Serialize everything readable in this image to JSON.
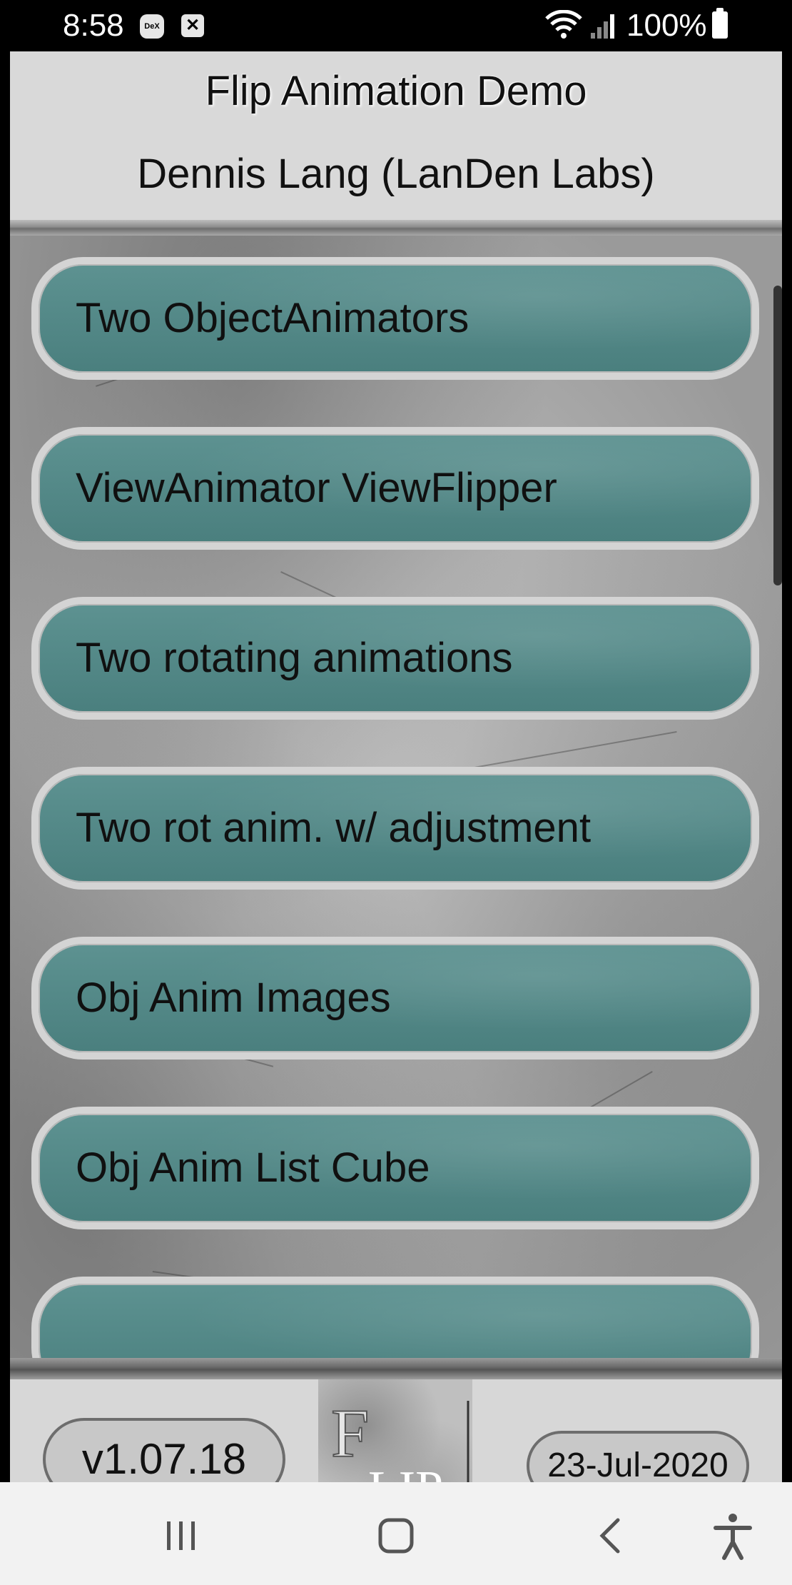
{
  "status_bar": {
    "time": "8:58",
    "dex_badge": "DeX",
    "battery_text": "100%",
    "icons": [
      "dex-icon",
      "close-notification-icon",
      "wifi-icon",
      "signal-icon",
      "battery-icon"
    ]
  },
  "header": {
    "title": "Flip Animation Demo",
    "subtitle": "Dennis Lang (LanDen Labs)"
  },
  "menu": {
    "items": [
      {
        "label": "Two ObjectAnimators"
      },
      {
        "label": "ViewAnimator ViewFlipper"
      },
      {
        "label": "Two rotating animations"
      },
      {
        "label": "Two rot anim. w/ adjustment"
      },
      {
        "label": "Obj Anim Images"
      },
      {
        "label": "Obj Anim List Cube"
      }
    ],
    "accent_color": "#558a89"
  },
  "footer": {
    "version": "v1.07.18",
    "logo_text": "FLIP",
    "date": "23-Jul-2020"
  },
  "nav_bar": {
    "icons": [
      "recent-apps-icon",
      "home-icon",
      "back-icon",
      "accessibility-icon"
    ]
  }
}
